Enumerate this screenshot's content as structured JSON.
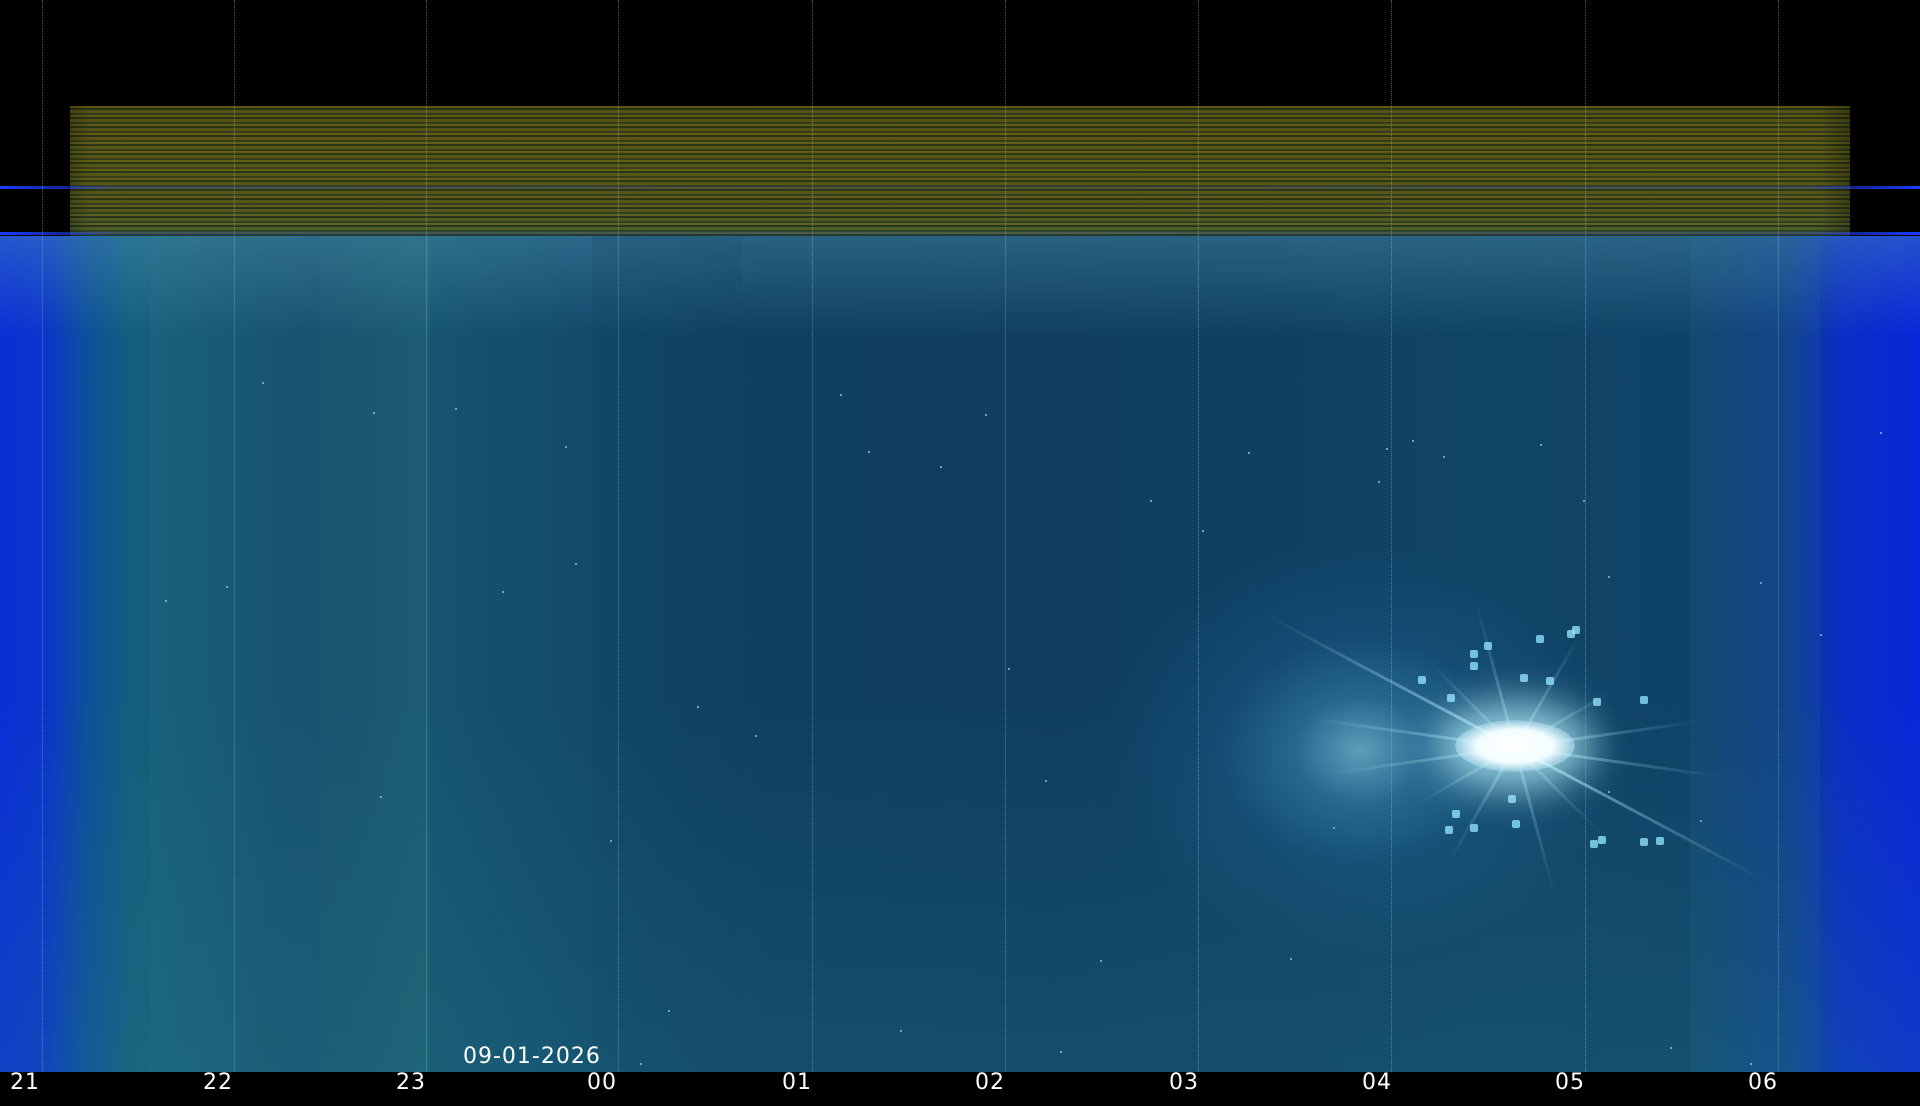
{
  "date_label": "09-01-2026",
  "hour_labels": [
    "21",
    "22",
    "23",
    "00",
    "01",
    "02",
    "03",
    "04",
    "05",
    "06"
  ]
}
